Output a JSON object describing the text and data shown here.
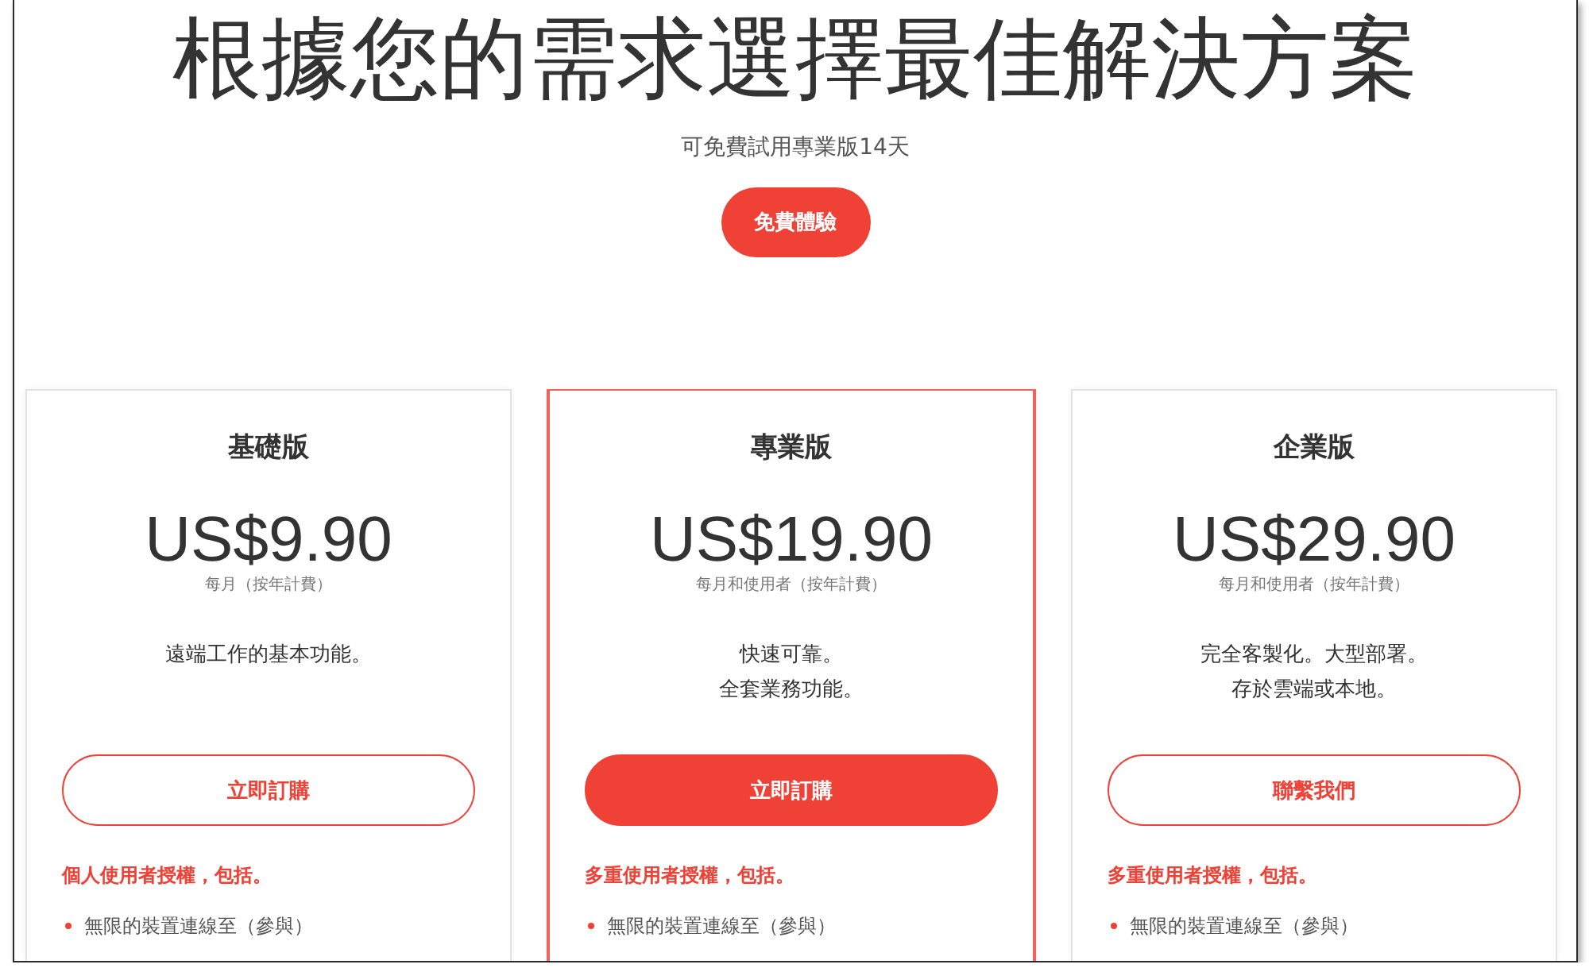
{
  "header": {
    "title": "根據您的需求選擇最佳解決方案",
    "subtitle": "可免費試用專業版14天",
    "trial_button": "免費體驗"
  },
  "plans": [
    {
      "name": "基礎版",
      "price": "US$9.90",
      "billing": "每月（按年計費）",
      "description": [
        "遠端工作的基本功能。"
      ],
      "highlighted": false,
      "button": {
        "label": "立即訂購",
        "kind": "outline"
      },
      "license_heading": "個人使用者授權，包括。",
      "features": [
        "無限的裝置連線至（參與）"
      ]
    },
    {
      "name": "專業版",
      "price": "US$19.90",
      "billing": "每月和使用者（按年計費）",
      "description": [
        "快速可靠。",
        "全套業務功能。"
      ],
      "highlighted": true,
      "button": {
        "label": "立即訂購",
        "kind": "filled"
      },
      "license_heading": "多重使用者授權，包括。",
      "features": [
        "無限的裝置連線至（參與）"
      ]
    },
    {
      "name": "企業版",
      "price": "US$29.90",
      "billing": "每月和使用者（按年計費）",
      "description": [
        "完全客製化。大型部署。",
        "存於雲端或本地。"
      ],
      "highlighted": false,
      "button": {
        "label": "聯繫我們",
        "kind": "outline"
      },
      "license_heading": "多重使用者授權，包括。",
      "features": [
        "無限的裝置連線至（參與）"
      ]
    }
  ]
}
